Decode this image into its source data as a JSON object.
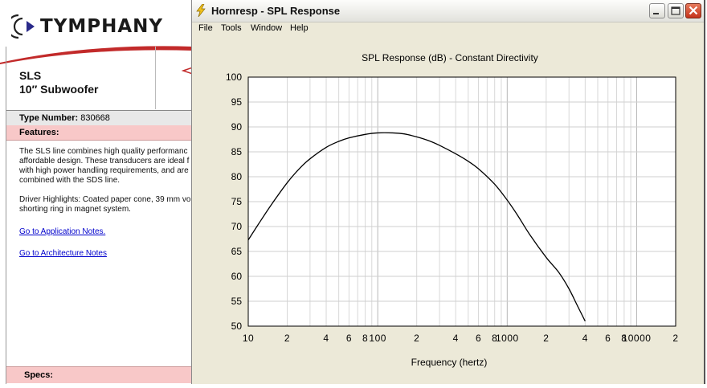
{
  "background_page": {
    "logo_text": "TYMPHANY",
    "product_line": "SLS",
    "product_desc": "10″ Subwoofer",
    "type_number_label": "Type Number:",
    "type_number_value": "830668",
    "features_label": "Features:",
    "features_lines": [
      "The SLS line combines high quality performanc",
      "affordable design. These transducers are ideal f",
      "with high power handling requirements, and are",
      "combined with the SDS line."
    ],
    "highlights_lines": [
      "Driver Highlights: Coated paper cone, 39 mm vo",
      "shorting ring in magnet system."
    ],
    "link_app_notes": "Go to Application Notes.",
    "link_arch_notes": "Go to Architecture Notes",
    "specs_label": "Specs:"
  },
  "window": {
    "title": "Hornresp - SPL Response",
    "menu": [
      "File",
      "Tools",
      "Window",
      "Help"
    ]
  },
  "chart_data": {
    "type": "line",
    "title": "SPL Response (dB) - Constant Directivity",
    "xlabel": "Frequency (hertz)",
    "ylabel": "",
    "x_scale": "log",
    "xlim": [
      10,
      20000
    ],
    "ylim": [
      50,
      100
    ],
    "x_ticks": [
      {
        "v": 10,
        "label": "10"
      },
      {
        "v": 20,
        "label": "2"
      },
      {
        "v": 40,
        "label": "4"
      },
      {
        "v": 60,
        "label": "6"
      },
      {
        "v": 80,
        "label": "8"
      },
      {
        "v": 100,
        "label": "100"
      },
      {
        "v": 200,
        "label": "2"
      },
      {
        "v": 400,
        "label": "4"
      },
      {
        "v": 600,
        "label": "6"
      },
      {
        "v": 800,
        "label": "8"
      },
      {
        "v": 1000,
        "label": "1000"
      },
      {
        "v": 2000,
        "label": "2"
      },
      {
        "v": 4000,
        "label": "4"
      },
      {
        "v": 6000,
        "label": "6"
      },
      {
        "v": 8000,
        "label": "8"
      },
      {
        "v": 10000,
        "label": "10000"
      },
      {
        "v": 20000,
        "label": "2"
      }
    ],
    "y_ticks": [
      100,
      95,
      90,
      85,
      80,
      75,
      70,
      65,
      60,
      55,
      50
    ],
    "grid": true,
    "series": [
      {
        "color": "#000000",
        "x": [
          10,
          12,
          15,
          20,
          25,
          30,
          40,
          50,
          60,
          80,
          100,
          130,
          160,
          200,
          250,
          300,
          400,
          500,
          600,
          800,
          1000,
          1200,
          1500,
          2000,
          2500,
          3000,
          3500,
          4000
        ],
        "y": [
          67.3,
          70.5,
          74.3,
          78.8,
          81.7,
          83.6,
          85.9,
          87.1,
          87.8,
          88.5,
          88.8,
          88.8,
          88.6,
          88.0,
          87.2,
          86.3,
          84.6,
          83.1,
          81.6,
          78.5,
          75.3,
          72.3,
          68.3,
          63.8,
          60.8,
          57.5,
          54.0,
          51.0
        ]
      }
    ]
  }
}
